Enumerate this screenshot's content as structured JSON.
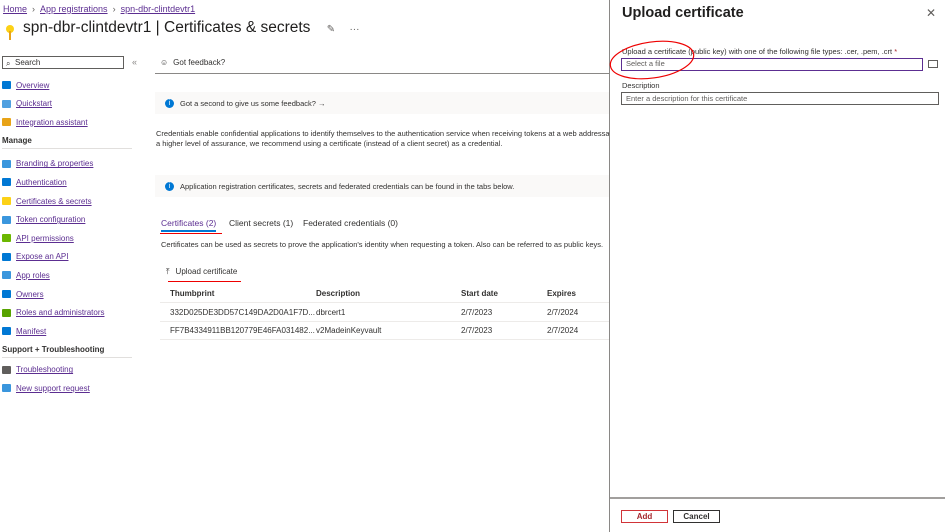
{
  "breadcrumb": [
    {
      "label": "Home"
    },
    {
      "label": "App registrations"
    },
    {
      "label": "spn-dbr-clintdevtr1"
    }
  ],
  "header": {
    "title": "spn-dbr-clintdevtr1 | Certificates & secrets",
    "pin_icon": "pin-icon",
    "more": "···"
  },
  "sidebar": {
    "search_placeholder": "Search",
    "collapse": "«",
    "top_items": [
      {
        "label": "Overview",
        "color": "#0078d4"
      },
      {
        "label": "Quickstart",
        "color": "#50a0e0"
      },
      {
        "label": "Integration assistant",
        "color": "#e8a317"
      }
    ],
    "manage_title": "Manage",
    "manage_items": [
      {
        "label": "Branding & properties",
        "color": "#3a96dd"
      },
      {
        "label": "Authentication",
        "color": "#0078d4"
      },
      {
        "label": "Certificates & secrets",
        "color": "#fcd116"
      },
      {
        "label": "Token configuration",
        "color": "#3a96dd"
      },
      {
        "label": "API permissions",
        "color": "#6bb700"
      },
      {
        "label": "Expose an API",
        "color": "#0078d4"
      },
      {
        "label": "App roles",
        "color": "#3a96dd"
      },
      {
        "label": "Owners",
        "color": "#0078d4"
      },
      {
        "label": "Roles and administrators",
        "color": "#57a300"
      },
      {
        "label": "Manifest",
        "color": "#0078d4"
      }
    ],
    "support_title": "Support + Troubleshooting",
    "support_items": [
      {
        "label": "Troubleshooting",
        "color": "#605e5c"
      },
      {
        "label": "New support request",
        "color": "#3a96dd"
      }
    ]
  },
  "main": {
    "feedback_label": "Got feedback?",
    "feedback_banner": "Got a second to give us some feedback? →",
    "intro": "Credentials enable confidential applications to identify themselves to the authentication service when receiving tokens at a web addressable location (using an HTTPS scheme). For a higher level of assurance, we recommend using a certificate (instead of a client secret) as a credential.",
    "info_banner": "Application registration certificates, secrets and federated credentials can be found in the tabs below.",
    "tabs": [
      {
        "label": "Certificates (2)"
      },
      {
        "label": "Client secrets (1)"
      },
      {
        "label": "Federated credentials (0)"
      }
    ],
    "tab_desc": "Certificates can be used as secrets to prove the application's identity when requesting a token. Also can be referred to as public keys.",
    "upload_label": "Upload certificate",
    "columns": [
      "Thumbprint",
      "Description",
      "Start date",
      "Expires"
    ],
    "rows": [
      [
        "332D025DE3DD57C149DA2D0A1F7D...",
        "dbrcert1",
        "2/7/2023",
        "2/7/2024"
      ],
      [
        "FF7B4334911BB120779E46FA031482...",
        "v2MadeinKeyvault",
        "2/7/2023",
        "2/7/2024"
      ]
    ]
  },
  "panel": {
    "title": "Upload certificate",
    "file_label": "Upload a certificate (public key) with one of the following file types: .cer, .pem, .crt",
    "required": "*",
    "file_placeholder": "Select a file",
    "desc_label": "Description",
    "desc_placeholder": "Enter a description for this certificate",
    "add": "Add",
    "cancel": "Cancel"
  },
  "colors": {
    "accent": "#5c2e91",
    "annotation": "#e00000",
    "link": "#5c2e91"
  }
}
